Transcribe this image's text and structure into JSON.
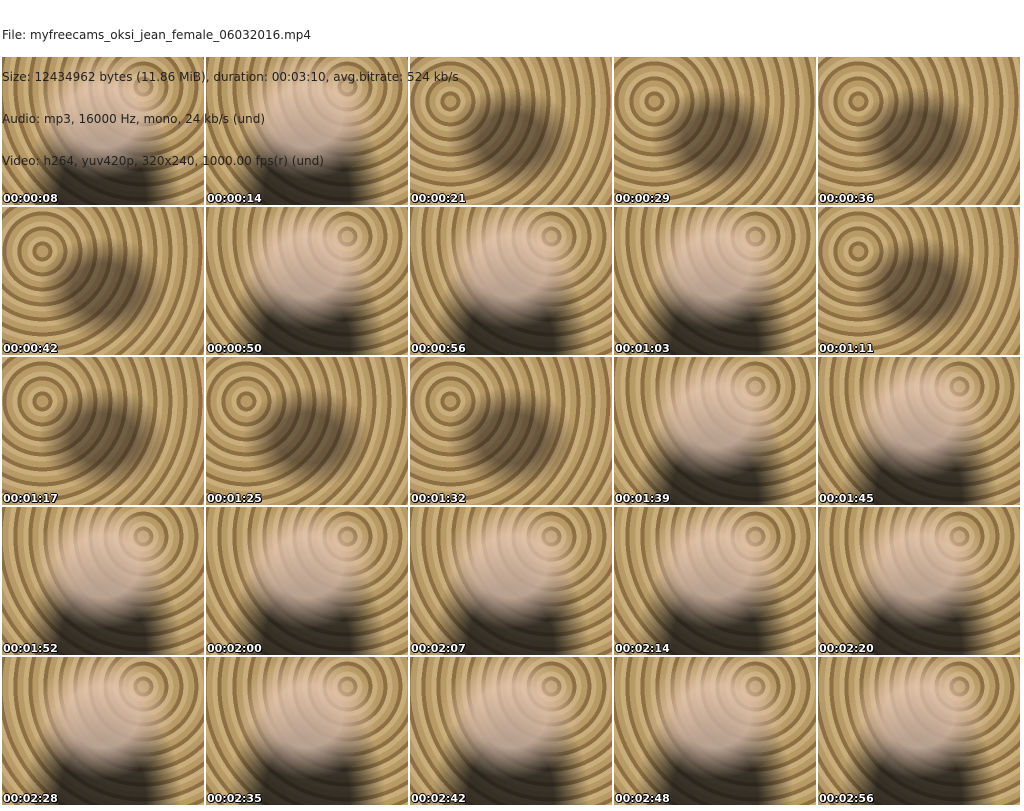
{
  "header": {
    "file": "File: myfreecams_oksi_jean_female_06032016.mp4",
    "size": "Size: 12434962 bytes (11.86 MiB), duration: 00:03:10, avg.bitrate: 524 kb/s",
    "audio": "Audio: mp3, 16000 Hz, mono, 24 kb/s (und)",
    "video": "Video: h264, yuv420p, 320x240, 1000.00 fps(r) (und)"
  },
  "thumbnails": [
    "00:00:08",
    "00:00:14",
    "00:00:21",
    "00:00:29",
    "00:00:36",
    "00:00:42",
    "00:00:50",
    "00:00:56",
    "00:01:03",
    "00:01:11",
    "00:01:17",
    "00:01:25",
    "00:01:32",
    "00:01:39",
    "00:01:45",
    "00:01:52",
    "00:02:00",
    "00:02:07",
    "00:02:14",
    "00:02:20",
    "00:02:28",
    "00:02:35",
    "00:02:42",
    "00:02:48",
    "00:02:56"
  ]
}
